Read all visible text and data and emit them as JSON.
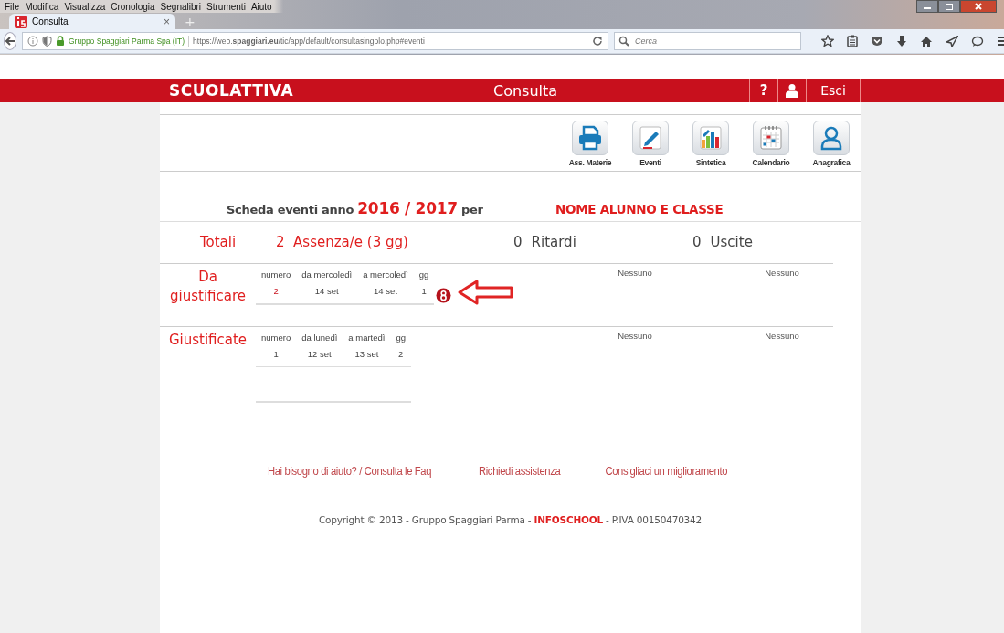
{
  "browser": {
    "menu": [
      "File",
      "Modifica",
      "Visualizza",
      "Cronologia",
      "Segnalibri",
      "Strumenti",
      "Aiuto"
    ],
    "tab": {
      "title": "Consulta",
      "close": "×",
      "new": "+"
    },
    "identity": "Gruppo Spaggiari Parma Spa (IT)",
    "url": "https://web.**spaggiari.eu**/tic/app/default/consultasingolo.php#eventi",
    "search": {
      "placeholder": "Cerca"
    }
  },
  "header": {
    "logo": "SCUOLATTIVA",
    "title": "Consulta",
    "help": "?",
    "logout": "Esci"
  },
  "toolbar": [
    {
      "kind": "printer",
      "label": "Ass. Materie"
    },
    {
      "kind": "pen",
      "label": "Eventi"
    },
    {
      "kind": "chart",
      "label": "Sintetica"
    },
    {
      "kind": "calendar",
      "label": "Calendario"
    },
    {
      "kind": "person",
      "label": "Anagrafica"
    }
  ],
  "heading": {
    "title": "Scheda eventi anno **2016 / 2017** per",
    "student": "NOME ALUNNO E CLASSE"
  },
  "totals": {
    "label": "Totali",
    "absences": "2  Assenza/e (3 gg)",
    "delays_count": "0",
    "delays": "Ritardi",
    "exits_count": "0",
    "exits": "Uscite"
  },
  "sections": [
    {
      "label": "Da giustificare",
      "columns": [
        "numero",
        "da mercoledì",
        "a mercoledì",
        "gg"
      ],
      "rows": [
        [
          "2",
          "14 set",
          "14 set",
          "1"
        ]
      ],
      "pending": true,
      "delays": "Nessuno",
      "exits": "Nessuno"
    },
    {
      "label": "Giustificate",
      "columns": [
        "numero",
        "da lunedì",
        "a martedì",
        "gg"
      ],
      "rows": [
        [
          "1",
          "12 set",
          "13 set",
          "2"
        ]
      ],
      "pending": false,
      "delays": "Nessuno",
      "exits": "Nessuno"
    }
  ],
  "footer": {
    "links": [
      "Hai bisogno di aiuto? / Consulta le Faq",
      "Richiedi assistenza",
      "Consigliaci un miglioramento"
    ],
    "copyright": "Copyright © 2013 - Gruppo Spaggiari Parma - **INFOSCHOOL** - P.IVA 00150470342"
  }
}
